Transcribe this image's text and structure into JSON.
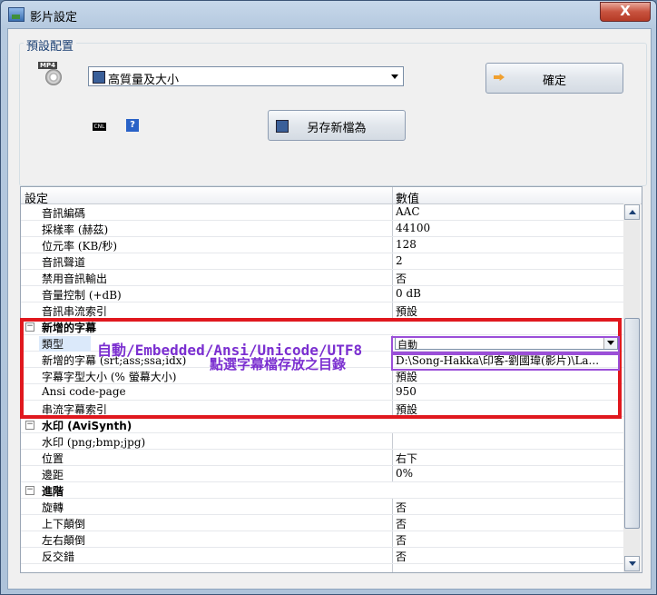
{
  "window": {
    "title": "影片設定",
    "close_label": "X"
  },
  "preset": {
    "group_label": "預設配置",
    "icon_tag": "MP4",
    "selected": "高質量及大小",
    "ok_label": "確定",
    "saveas_label": "另存新檔為",
    "small_icon_a": "CNL",
    "small_icon_b": "?"
  },
  "grid": {
    "header": {
      "name": "設定",
      "value": "數值"
    },
    "rows": [
      {
        "name": "音訊編碼",
        "value": "AAC"
      },
      {
        "name": "採樣率 (赫茲)",
        "value": "44100"
      },
      {
        "name": "位元率 (KB/秒)",
        "value": "128"
      },
      {
        "name": "音訊聲道",
        "value": "2"
      },
      {
        "name": "禁用音訊輸出",
        "value": "否"
      },
      {
        "name": "音量控制 (+dB)",
        "value": "0 dB"
      },
      {
        "name": "音訊串流索引",
        "value": "預設"
      },
      {
        "name": "新增的字幕",
        "value": "",
        "category": true,
        "toggle": "−"
      },
      {
        "name": "類型",
        "value": "自動",
        "selected": true
      },
      {
        "name": "新增的字幕 (srt;ass;ssa;idx)",
        "value": "D:\\Song-Hakka\\印客-劉國瑋(影片)\\La..."
      },
      {
        "name": "字幕字型大小 (% 螢幕大小)",
        "value": "預設"
      },
      {
        "name": "Ansi code-page",
        "value": "950"
      },
      {
        "name": "串流字幕索引",
        "value": "預設"
      },
      {
        "name": "水印 (AviSynth)",
        "value": "",
        "category": true,
        "toggle": "−"
      },
      {
        "name": "水印 (png;bmp;jpg)",
        "value": ""
      },
      {
        "name": "位置",
        "value": "右下"
      },
      {
        "name": "邊距",
        "value": "0%"
      },
      {
        "name": "進階",
        "value": "",
        "category": true,
        "toggle": "−"
      },
      {
        "name": "旋轉",
        "value": "否"
      },
      {
        "name": "上下顛倒",
        "value": "否"
      },
      {
        "name": "左右顛倒",
        "value": "否"
      },
      {
        "name": "反交錯",
        "value": "否"
      }
    ]
  },
  "annotations": {
    "line1": "自動/Embedded/Ansi/Unicode/UTF8",
    "line2": "點選字幕檔存放之目錄"
  },
  "colors": {
    "highlight_box": "#e0181e",
    "annotation_text": "#7b2fd0"
  }
}
